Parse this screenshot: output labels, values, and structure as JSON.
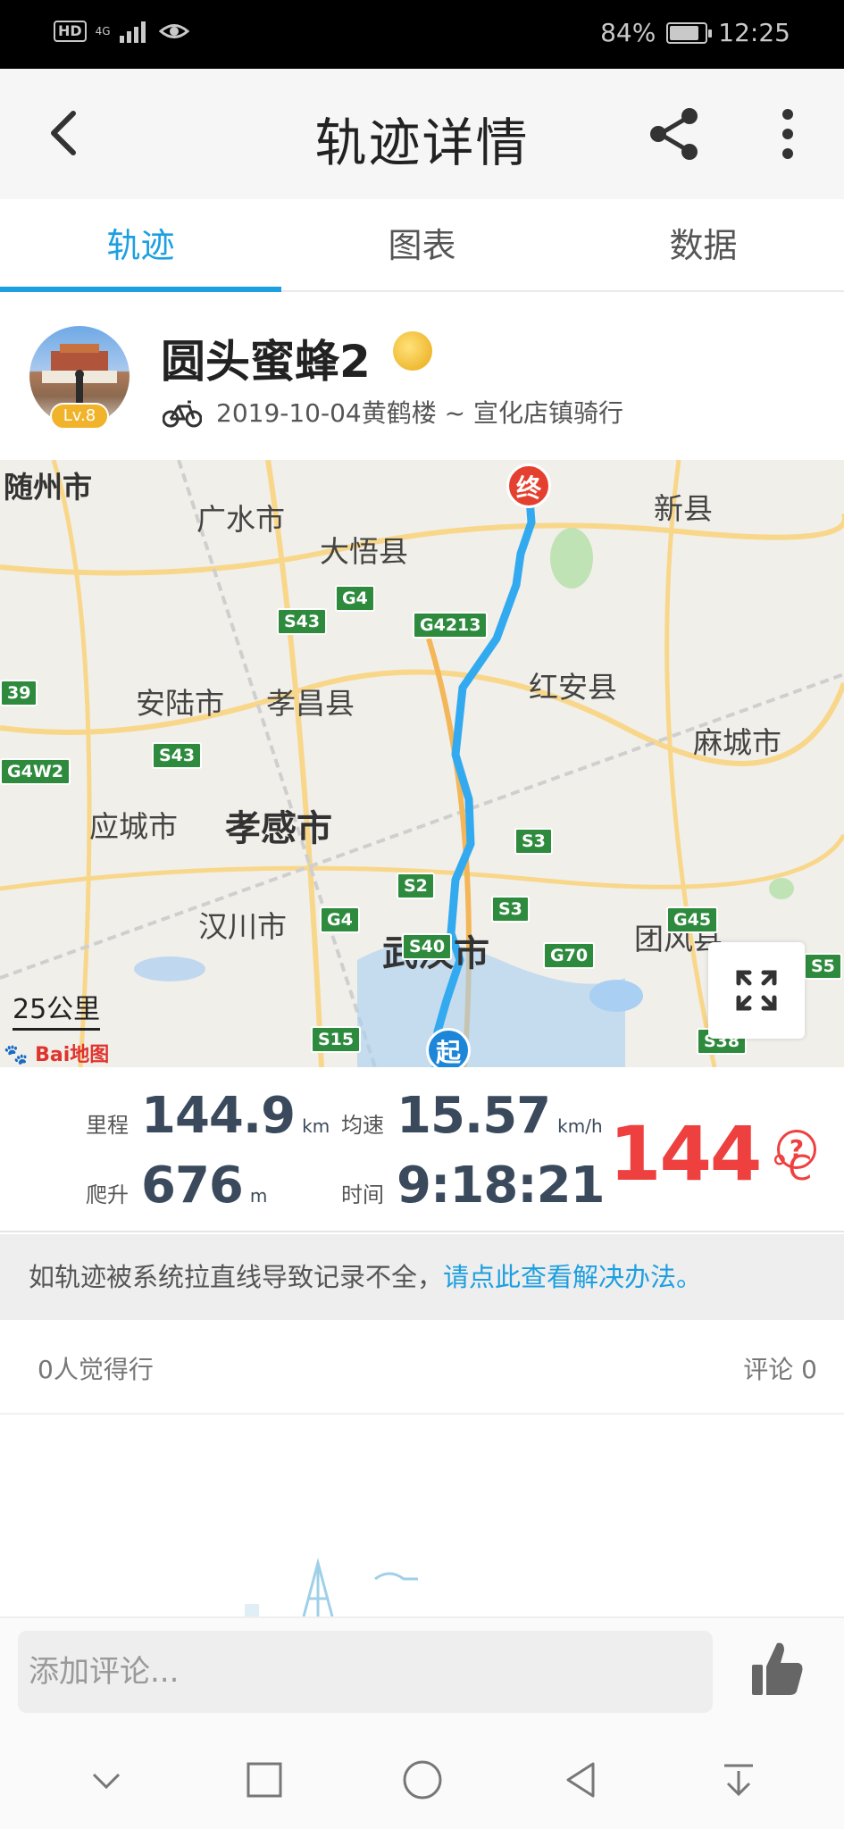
{
  "status_bar": {
    "hd": "HD",
    "network": "4G",
    "battery": "84%",
    "battery_level": 0.84,
    "time": "12:25"
  },
  "header": {
    "title": "轨迹详情",
    "back_icon": "back-arrow-icon",
    "share_icon": "share-icon",
    "more_icon": "more-vertical-icon"
  },
  "tabs": [
    {
      "label": "轨迹",
      "active": true
    },
    {
      "label": "图表",
      "active": false
    },
    {
      "label": "数据",
      "active": false
    }
  ],
  "user": {
    "name": "圆头蜜蜂2",
    "level": "Lv.8",
    "route": "2019-10-04黄鹤楼 ~ 宣化店镇骑行"
  },
  "map": {
    "labels": [
      "随州市",
      "广水市",
      "大悟县",
      "新县",
      "安陆市",
      "孝昌县",
      "红安县",
      "麻城市",
      "应城市",
      "孝感市",
      "汉川市",
      "武汉市",
      "团风县"
    ],
    "roads": [
      "G4",
      "S43",
      "G4213",
      "S43",
      "G4W2",
      "S3",
      "S2",
      "S3",
      "G4",
      "S40",
      "G70",
      "G45",
      "S5",
      "S15",
      "S38",
      "39"
    ],
    "end_pin": "终",
    "start_pin": "起",
    "scale": "25公里",
    "logo": "Bai地图",
    "route_color": "#33aaf0"
  },
  "stats": {
    "distance": {
      "label": "里程",
      "value": "144.9",
      "unit": "km"
    },
    "avg_speed": {
      "label": "均速",
      "value": "15.57",
      "unit": "km/h"
    },
    "climb": {
      "label": "爬升",
      "value": "676",
      "unit": "m"
    },
    "duration": {
      "label": "时间",
      "value": "9:18:21"
    },
    "temperature": {
      "value": "144",
      "unit": "°C"
    },
    "help": "?"
  },
  "notice": {
    "text": "如轨迹被系统拉直线导致记录不全，",
    "link": "请点此查看解决办法。"
  },
  "social": {
    "likes": "0人觉得行",
    "comments": "评论 0"
  },
  "comment": {
    "placeholder": "添加评论..."
  },
  "colors": {
    "accent": "#1d9fe0",
    "temperature": "#ef4040",
    "stat_value": "#3a4a5c"
  }
}
